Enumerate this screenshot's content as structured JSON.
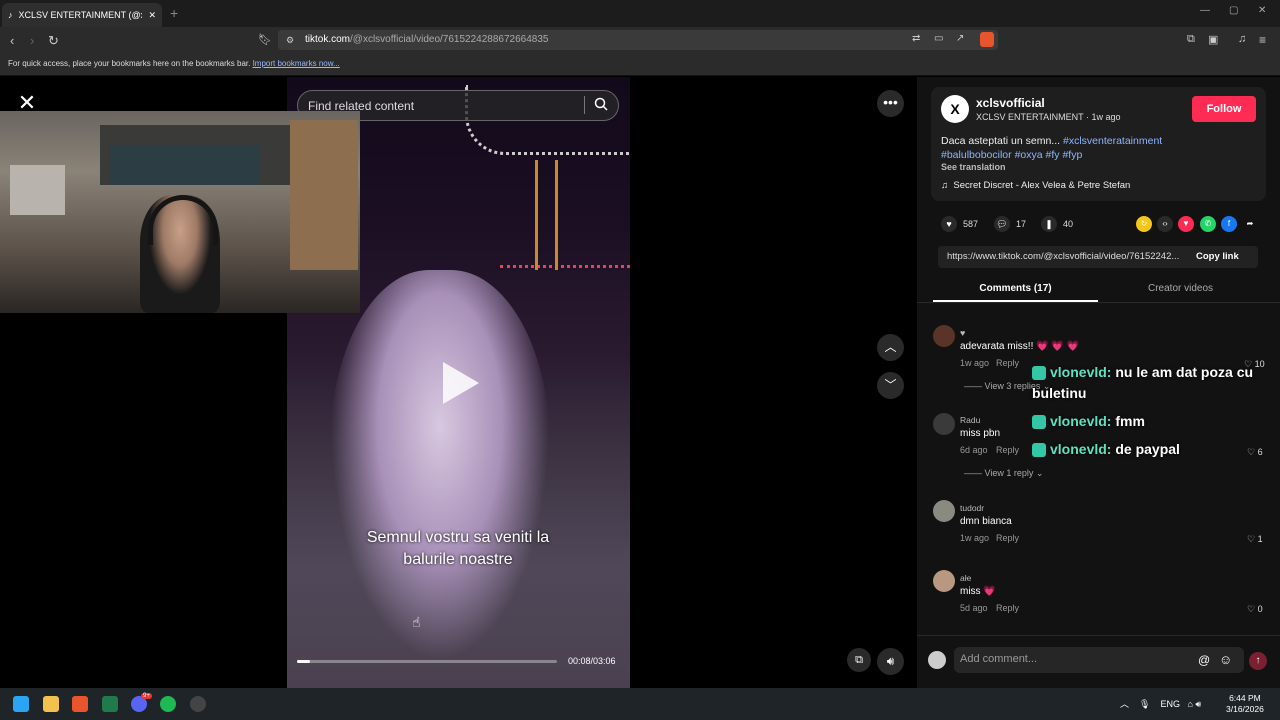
{
  "browser": {
    "tab_title": "XCLSV ENTERTAINMENT (@xclsv",
    "url_host": "tiktok.com",
    "url_path": "/@xclsvofficial/video/7615224288672664835",
    "bookmarks_hint": "For quick access, place your bookmarks here on the bookmarks bar.",
    "import_link": "Import bookmarks now..."
  },
  "video": {
    "search_placeholder": "Find related content",
    "caption_line1": "Semnul vostru sa veniti la",
    "caption_line2": "balurile noastre",
    "time": "00:08/03:06",
    "progress_fraction": 0.05
  },
  "post": {
    "username": "xclsvofficial",
    "display_name": "XCLSV ENTERTAINMENT",
    "age": "1w ago",
    "follow_label": "Follow",
    "desc_text": "Daca asteptati un semn... ",
    "tag1": "#xclsventeratainment",
    "tag2": "#balulbobocilor",
    "tag3": "#oxya",
    "tag4": "#fy",
    "tag5": "#fyp",
    "see_translation": "See translation",
    "music": "Secret Discret - Alex Velea & Petre Stefan",
    "likes": "587",
    "comments": "17",
    "saves": "40",
    "link": "https://www.tiktok.com/@xclsvofficial/video/76152242...",
    "copy_link": "Copy link"
  },
  "tabs": {
    "comments": "Comments (17)",
    "creator": "Creator videos"
  },
  "comments": [
    {
      "user": "",
      "text": "adevarata miss!! 💗 💗 💗",
      "age": "1w ago",
      "reply": "Reply",
      "likes": "10",
      "views": "View 3 replies"
    },
    {
      "user": "Radu",
      "text": "miss pbn",
      "age": "6d ago",
      "reply": "Reply",
      "likes": "6",
      "views": "View 1 reply"
    },
    {
      "user": "tudodr",
      "text": "dmn bianca",
      "age": "1w ago",
      "reply": "Reply",
      "likes": "1"
    },
    {
      "user": "ałe",
      "text": "miss 💗",
      "age": "5d ago",
      "reply": "Reply",
      "likes": "0"
    }
  ],
  "chat": [
    {
      "name": "vlonevld:",
      "msg": "nu le am dat poza cu",
      "msg2": "buletinu"
    },
    {
      "name": "vlonevld:",
      "msg": "fmm"
    },
    {
      "name": "vlonevld:",
      "msg": "de paypal"
    }
  ],
  "add_comment_placeholder": "Add comment...",
  "taskbar": {
    "lang": "ENG",
    "time": "6:44 PM",
    "date": "3/16/2026",
    "discord_badge": "9+"
  },
  "colors": {
    "follow": "#fe2c55",
    "tag": "#8eb5ff",
    "chat_name": "#5be3c0"
  }
}
